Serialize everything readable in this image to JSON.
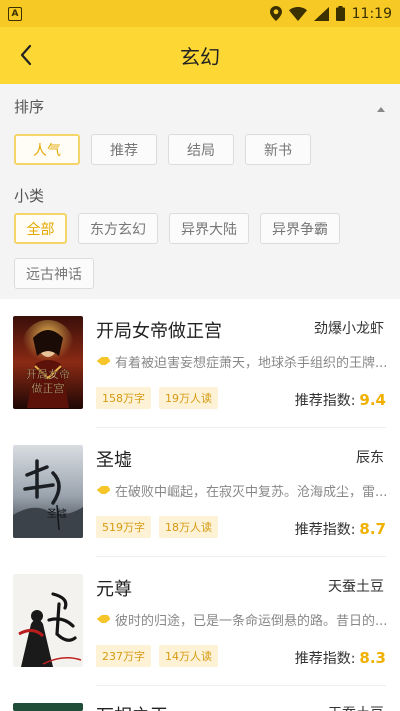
{
  "status_bar": {
    "time": "11:19",
    "app_icon_letter": "A"
  },
  "header": {
    "title": "玄幻"
  },
  "sort": {
    "label": "排序",
    "chips": [
      {
        "label": "人气",
        "active": true
      },
      {
        "label": "推荐",
        "active": false
      },
      {
        "label": "结局",
        "active": false
      },
      {
        "label": "新书",
        "active": false
      }
    ]
  },
  "subcategory": {
    "label": "小类",
    "chips": [
      {
        "label": "全部",
        "active": true
      },
      {
        "label": "东方玄幻",
        "active": false
      },
      {
        "label": "异界大陆",
        "active": false
      },
      {
        "label": "异界争霸",
        "active": false
      },
      {
        "label": "远古神话",
        "active": false
      }
    ]
  },
  "books": [
    {
      "title": "开局女帝做正宫",
      "author": "劲爆小龙虾",
      "desc": "有着被迫害妄想症萧天，地球杀手组织的王牌...",
      "words": "158万字",
      "readers": "19万人读",
      "score_label": "推荐指数:",
      "score": "9.4",
      "cover_text": "开局女帝做正宫"
    },
    {
      "title": "圣墟",
      "author": "辰东",
      "desc": "在破败中崛起，在寂灭中复苏。沧海成尘，雷...",
      "words": "519万字",
      "readers": "18万人读",
      "score_label": "推荐指数:",
      "score": "8.7",
      "cover_text": "圣墟"
    },
    {
      "title": "元尊",
      "author": "天蚕土豆",
      "desc": "彼时的归途，已是一条命运倒悬的路。昔日的...",
      "words": "237万字",
      "readers": "14万人读",
      "score_label": "推荐指数:",
      "score": "8.3",
      "cover_text": "元尊"
    },
    {
      "title": "万相之王",
      "author": "天蚕土豆",
      "desc": "",
      "words": "",
      "readers": "",
      "score_label": "",
      "score": "",
      "cover_text": ""
    }
  ],
  "colors": {
    "accent": "#fdd835",
    "score": "#f0b000",
    "badge_bg": "#fdf2d6",
    "badge_text": "#d59a12"
  }
}
